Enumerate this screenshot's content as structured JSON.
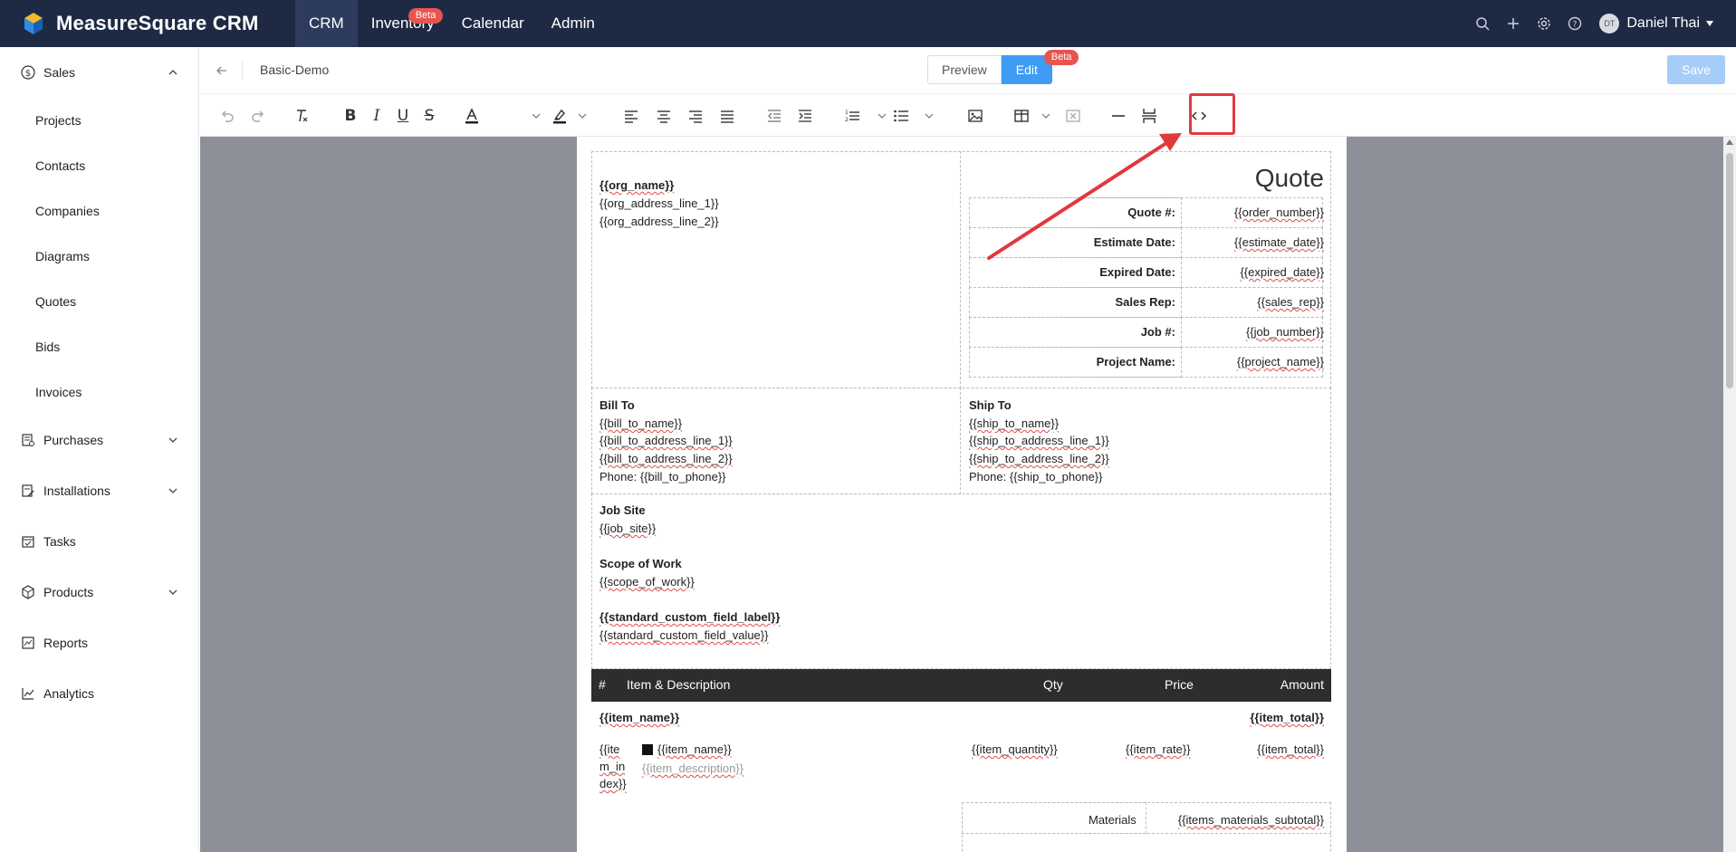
{
  "app": {
    "title": "MeasureSquare CRM",
    "nav": [
      {
        "label": "CRM",
        "active": true
      },
      {
        "label": "Inventory",
        "badge": "Beta"
      },
      {
        "label": "Calendar"
      },
      {
        "label": "Admin"
      }
    ],
    "user": {
      "initials": "DT",
      "name": "Daniel Thai"
    }
  },
  "sidebar": {
    "sales": "Sales",
    "sales_items": [
      "Projects",
      "Contacts",
      "Companies",
      "Diagrams",
      "Quotes",
      "Bids",
      "Invoices"
    ],
    "purchases": "Purchases",
    "installations": "Installations",
    "tasks": "Tasks",
    "products": "Products",
    "reports": "Reports",
    "analytics": "Analytics"
  },
  "editor": {
    "doc_name": "Basic-Demo",
    "preview_label": "Preview",
    "edit_label": "Edit",
    "edit_badge": "Beta",
    "save_label": "Save"
  },
  "colors": {
    "nav_bg": "#1e2a44",
    "accent": "#3f9cf5",
    "highlight": "#e0393e"
  },
  "template": {
    "org_name": "{{org_name}}",
    "org_address_line_1": "{{org_address_line_1}}",
    "org_address_line_2": "{{org_address_line_2}}",
    "quote_title": "Quote",
    "quote_rows": [
      {
        "label": "Quote #:",
        "value": "{{order_number}}"
      },
      {
        "label": "Estimate Date:",
        "value": "{{estimate_date}}"
      },
      {
        "label": "Expired Date:",
        "value": "{{expired_date}}"
      },
      {
        "label": "Sales Rep:",
        "value": "{{sales_rep}}"
      },
      {
        "label": "Job #:",
        "value": "{{job_number}}"
      },
      {
        "label": "Project Name:",
        "value": "{{project_name}}"
      }
    ],
    "bill_to": {
      "heading": "Bill To",
      "lines": [
        "{{bill_to_name}}",
        "{{bill_to_address_line_1}}",
        "{{bill_to_address_line_2}}",
        "Phone: {{bill_to_phone}}"
      ]
    },
    "ship_to": {
      "heading": "Ship To",
      "lines": [
        "{{ship_to_name}}",
        "{{ship_to_address_line_1}}",
        "{{ship_to_address_line_2}}",
        "Phone: {{ship_to_phone}}"
      ]
    },
    "job_site_heading": "Job Site",
    "job_site_value": "{{job_site}}",
    "scope_heading": "Scope of Work",
    "scope_value": "{{scope_of_work}}",
    "custom_label": "{{standard_custom_field_label}}",
    "custom_value": "{{standard_custom_field_value}}",
    "items_header": {
      "num": "#",
      "item": "Item & Description",
      "qty": "Qty",
      "price": "Price",
      "amount": "Amount"
    },
    "group_name": "{{item_name}}",
    "group_total": "{{item_total}}",
    "row": {
      "index_lines": [
        "{{ite",
        "m_in",
        "dex}}"
      ],
      "name": "{{item_name}}",
      "description": "{{item_description}}",
      "quantity": "{{item_quantity}}",
      "rate": "{{item_rate}}",
      "total": "{{item_total}}"
    },
    "materials_label": "Materials",
    "materials_value": "{{items_materials_subtotal}}"
  }
}
